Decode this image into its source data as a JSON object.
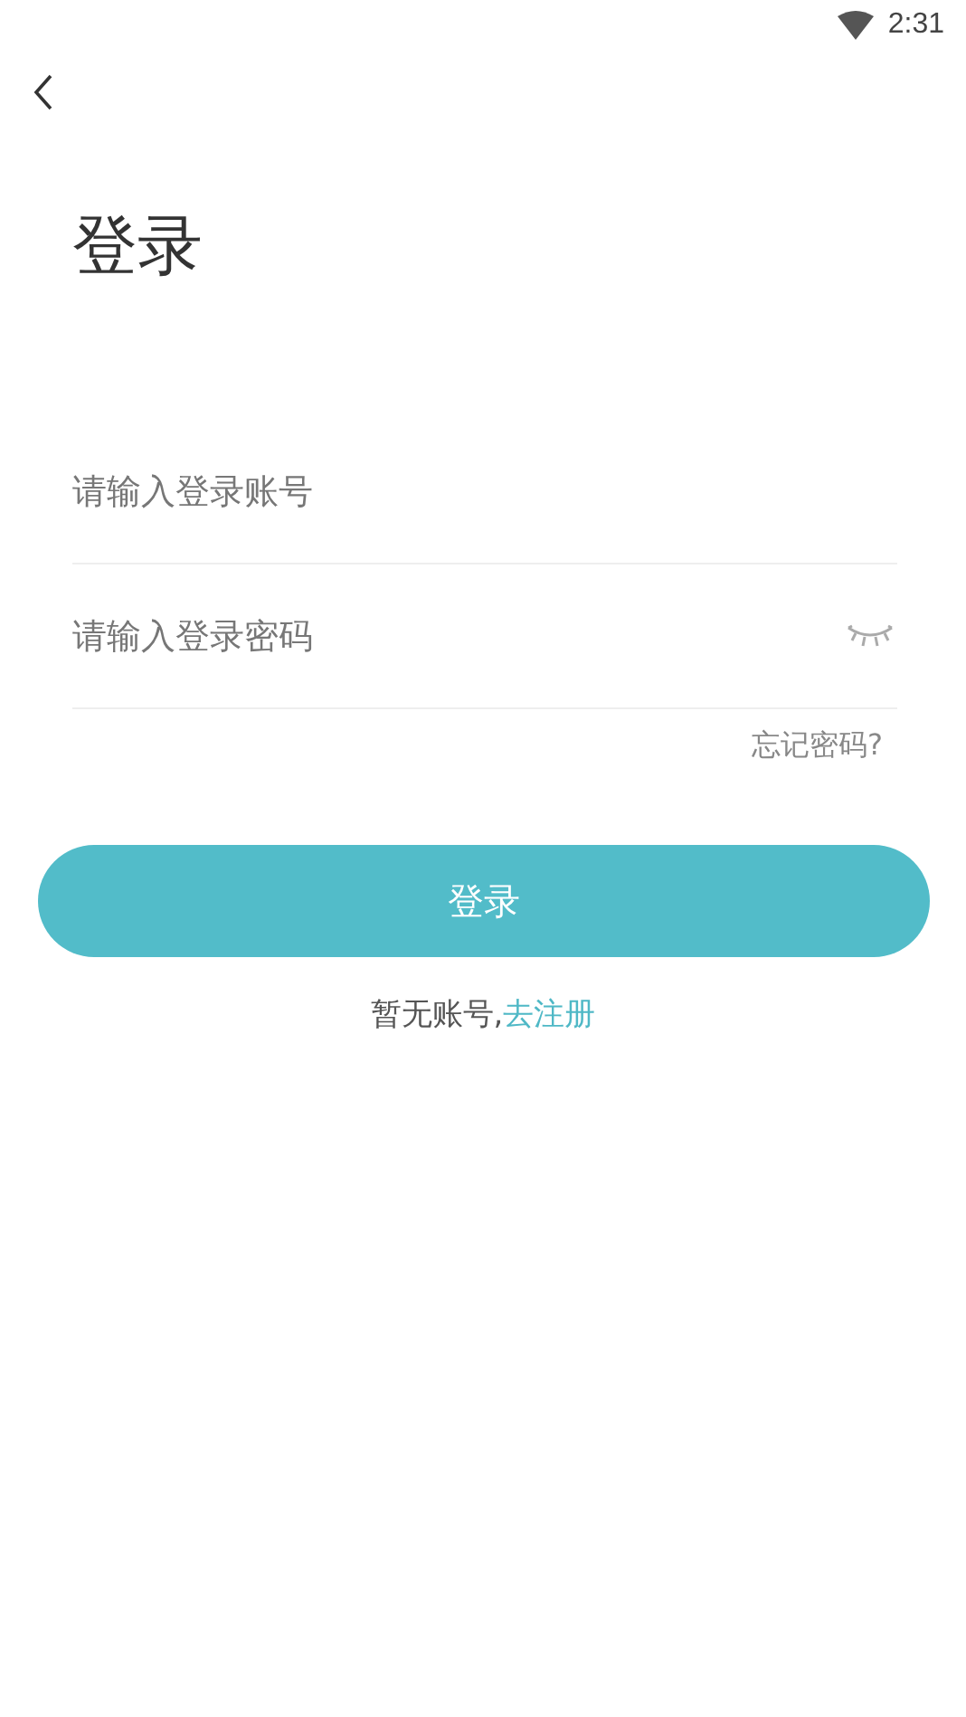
{
  "status_bar": {
    "time": "2:31"
  },
  "title": "登录",
  "account_field": {
    "placeholder": "请输入登录账号"
  },
  "password_field": {
    "placeholder": "请输入登录密码",
    "visible": false
  },
  "forgot_link": "忘记密码?",
  "login_button": "登录",
  "register": {
    "prompt": "暂无账号,",
    "link": "去注册"
  }
}
